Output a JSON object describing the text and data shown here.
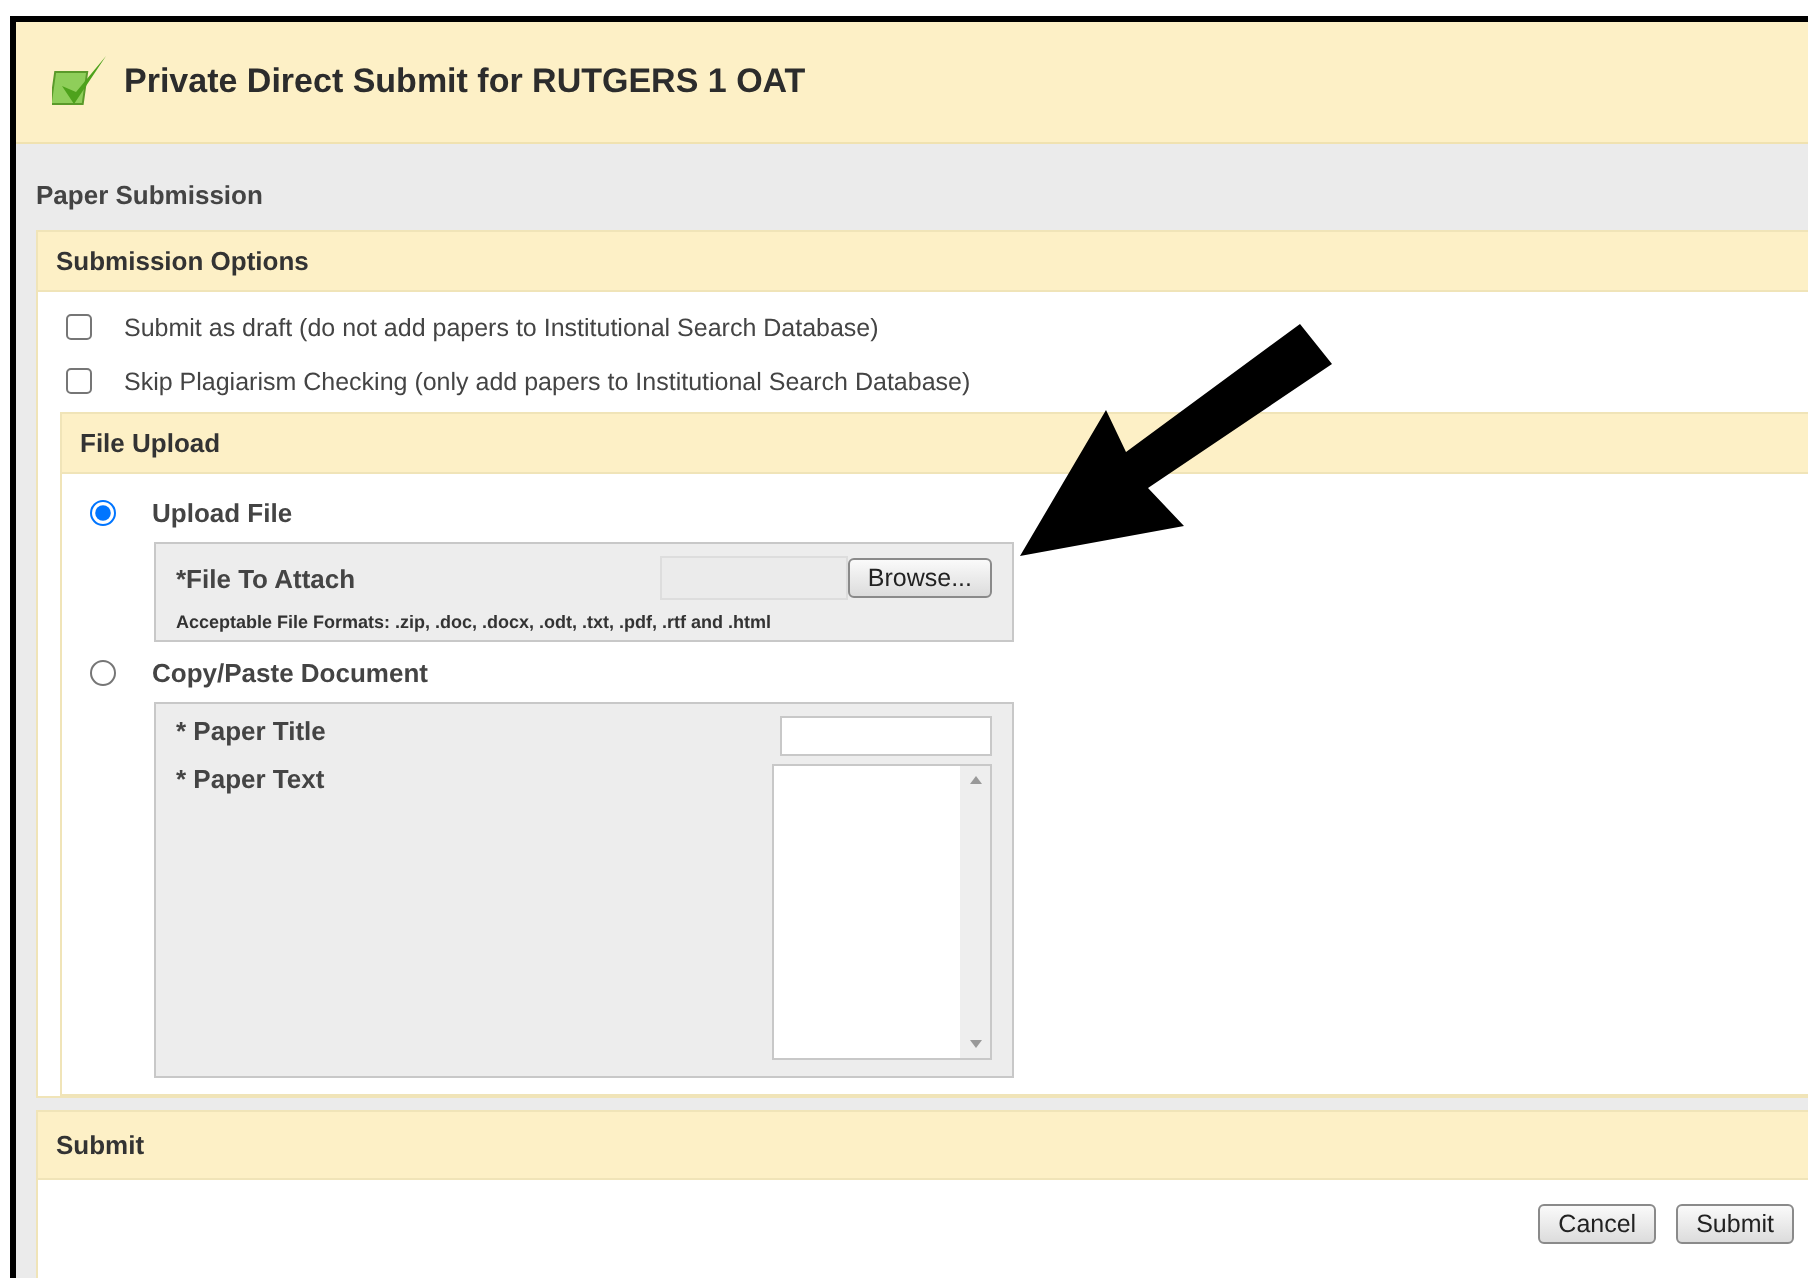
{
  "window": {
    "title": "Private Direct Submit for RUTGERS 1 OAT"
  },
  "page_heading": "Paper Submission",
  "submission_options": {
    "heading": "Submission Options",
    "options": [
      {
        "label": "Submit as draft (do not add papers to Institutional Search Database)",
        "checked": false
      },
      {
        "label": "Skip Plagiarism Checking (only add papers to Institutional Search Database)",
        "checked": false
      }
    ]
  },
  "file_upload": {
    "heading": "File Upload",
    "methods": [
      {
        "kind": "upload",
        "label": "Upload File",
        "selected": true,
        "field_label": "*File To Attach",
        "button": "Browse...",
        "note": "Acceptable File Formats: .zip, .doc, .docx, .odt, .txt, .pdf, .rtf and .html"
      },
      {
        "kind": "paste",
        "label": "Copy/Paste Document",
        "selected": false,
        "title_label": "* Paper Title",
        "text_label": "* Paper Text"
      }
    ]
  },
  "submit": {
    "heading": "Submit",
    "buttons": [
      "Cancel",
      "Submit"
    ]
  }
}
